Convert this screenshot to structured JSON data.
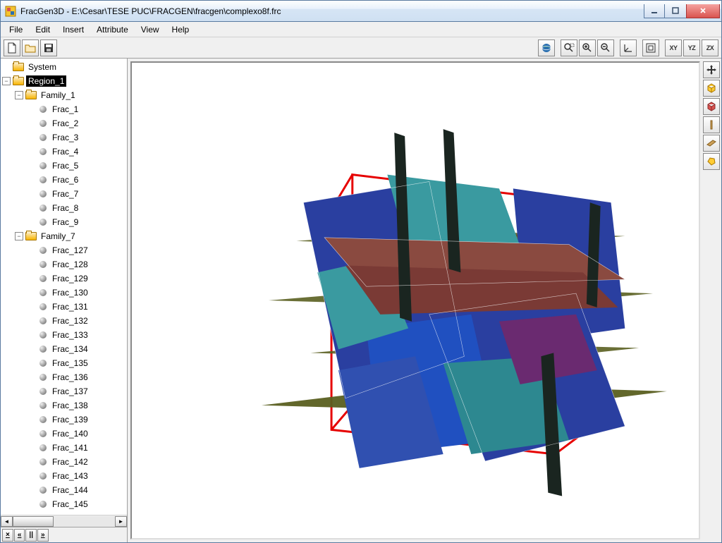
{
  "window": {
    "title": "FracGen3D - E:\\Cesar\\TESE PUC\\FRACGEN\\fracgen\\complexo8f.frc"
  },
  "menu": {
    "items": [
      "File",
      "Edit",
      "Insert",
      "Attribute",
      "View",
      "Help"
    ]
  },
  "toolbar": {
    "left": [
      {
        "name": "new-file-icon",
        "label": "New"
      },
      {
        "name": "open-file-icon",
        "label": "Open"
      },
      {
        "name": "save-file-icon",
        "label": "Save"
      }
    ],
    "right": [
      {
        "name": "globe-icon",
        "label": "World"
      },
      {
        "name": "zoom-window-icon",
        "label": "Zoom Window"
      },
      {
        "name": "zoom-in-icon",
        "label": "Zoom In"
      },
      {
        "name": "zoom-out-icon",
        "label": "Zoom Out"
      },
      {
        "name": "axes-icon",
        "label": "Axes"
      },
      {
        "name": "fit-icon",
        "label": "Fit"
      },
      {
        "name": "view-xy-icon",
        "label": "XY"
      },
      {
        "name": "view-yz-icon",
        "label": "YZ"
      },
      {
        "name": "view-zx-icon",
        "label": "ZX"
      }
    ]
  },
  "right_tools": [
    {
      "name": "move-icon",
      "label": "Move"
    },
    {
      "name": "cube-yellow-icon",
      "label": "Bounding Box"
    },
    {
      "name": "cube-red-icon",
      "label": "Region Box"
    },
    {
      "name": "line-icon",
      "label": "Line"
    },
    {
      "name": "plane-icon",
      "label": "Plane"
    },
    {
      "name": "fracture-icon",
      "label": "Fracture"
    }
  ],
  "playback": [
    "×",
    "«",
    "||",
    "»"
  ],
  "tree": {
    "root": {
      "label": "System",
      "icon": "folder"
    },
    "region": {
      "label": "Region_1",
      "icon": "folder",
      "selected": true
    },
    "families": [
      {
        "label": "Family_1",
        "fractures": [
          "Frac_1",
          "Frac_2",
          "Frac_3",
          "Frac_4",
          "Frac_5",
          "Frac_6",
          "Frac_7",
          "Frac_8",
          "Frac_9"
        ]
      },
      {
        "label": "Family_7",
        "fractures": [
          "Frac_127",
          "Frac_128",
          "Frac_129",
          "Frac_130",
          "Frac_131",
          "Frac_132",
          "Frac_133",
          "Frac_134",
          "Frac_135",
          "Frac_136",
          "Frac_137",
          "Frac_138",
          "Frac_139",
          "Frac_140",
          "Frac_141",
          "Frac_142",
          "Frac_143",
          "Frac_144",
          "Frac_145"
        ]
      }
    ]
  }
}
